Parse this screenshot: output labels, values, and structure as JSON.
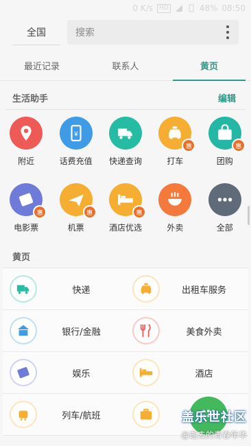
{
  "status_bar": {
    "net_speed": "0 K/s",
    "hd_badge": "HD",
    "battery": "48%",
    "time": "08:50"
  },
  "search_row": {
    "city": "全国",
    "search_placeholder": "搜索"
  },
  "tabs": [
    {
      "label": "最近记录",
      "active": false
    },
    {
      "label": "联系人",
      "active": false
    },
    {
      "label": "黄页",
      "active": true
    }
  ],
  "assistant": {
    "title": "生活助手",
    "edit_label": "编辑",
    "items": [
      {
        "label": "附近",
        "icon": "location-pin-icon",
        "color": "#ee5b56",
        "badge": ""
      },
      {
        "label": "话费充值",
        "icon": "phone-recharge-icon",
        "color": "#3f9be6",
        "badge": ""
      },
      {
        "label": "快递查询",
        "icon": "delivery-truck-icon",
        "color": "#25bca3",
        "badge": ""
      },
      {
        "label": "打车",
        "icon": "taxi-icon",
        "color": "#f5ad32",
        "badge": "惠"
      },
      {
        "label": "团购",
        "icon": "group-buy-icon",
        "color": "#24b7a6",
        "badge": "惠"
      },
      {
        "label": "电影票",
        "icon": "movie-ticket-icon",
        "color": "#6e7bd9",
        "badge": "惠"
      },
      {
        "label": "机票",
        "icon": "flight-ticket-icon",
        "color": "#f5ad32",
        "badge": "惠"
      },
      {
        "label": "酒店优选",
        "icon": "hotel-bed-icon",
        "color": "#f5ad32",
        "badge": "惠"
      },
      {
        "label": "外卖",
        "icon": "food-bowl-icon",
        "color": "#f37a3c",
        "badge": ""
      },
      {
        "label": "全部",
        "icon": "more-dots-icon",
        "color": "#5f6b79",
        "badge": ""
      }
    ]
  },
  "yellow_pages": {
    "title": "黄页",
    "items": [
      {
        "label": "快递",
        "icon": "delivery-truck-icon",
        "color": "#25bca3"
      },
      {
        "label": "出租车服务",
        "icon": "taxi-icon",
        "color": "#f5ad32"
      },
      {
        "label": "银行/金融",
        "icon": "bank-icon",
        "color": "#3f9be6"
      },
      {
        "label": "美食外卖",
        "icon": "fork-knife-icon",
        "color": "#ee5b56"
      },
      {
        "label": "娱乐",
        "icon": "movie-ticket-icon",
        "color": "#6e7bd9"
      },
      {
        "label": "酒店",
        "icon": "hotel-bed-icon",
        "color": "#f5ad32"
      },
      {
        "label": "列车/航班",
        "icon": "train-plane-icon",
        "color": "#f5ad32"
      },
      {
        "label": "",
        "icon": "briefcase-icon",
        "color": "#f5ad32"
      }
    ]
  },
  "watermark": {
    "line1": "盖乐世社区",
    "line2": "@逝去的青春年华"
  },
  "colors": {
    "accent": "#2b9a8a",
    "badge": "#e9702a",
    "fab": "#43b85c"
  }
}
